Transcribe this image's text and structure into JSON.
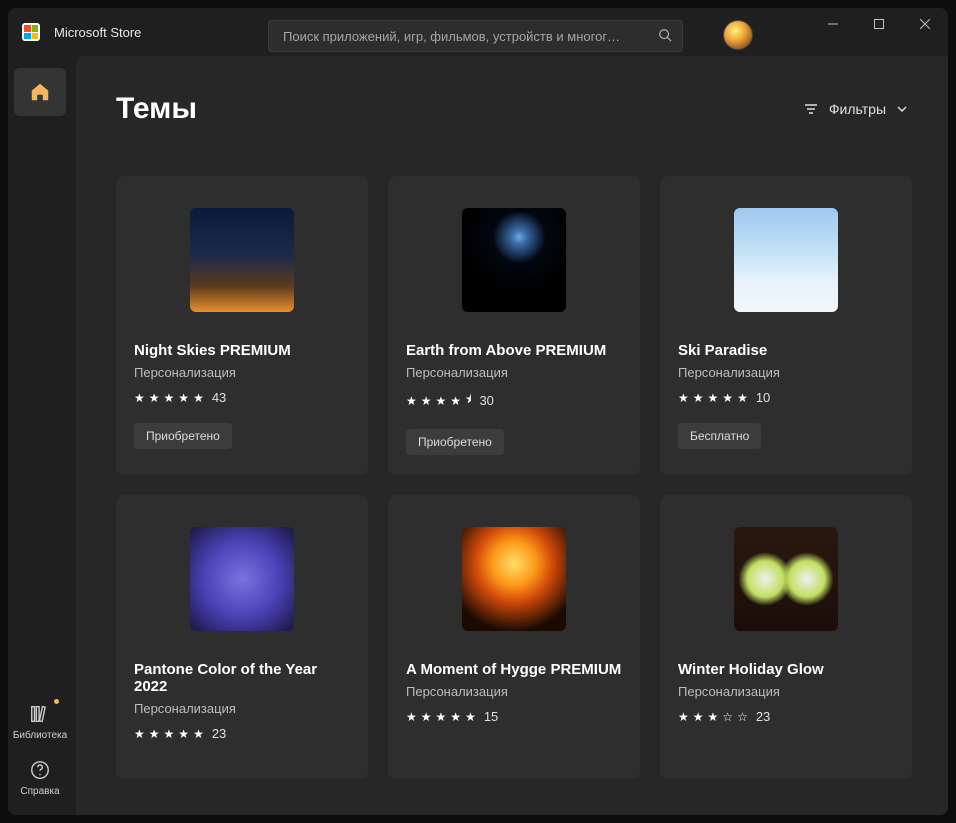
{
  "app": {
    "title": "Microsoft Store",
    "search_placeholder": "Поиск приложений, игр, фильмов, устройств и многог…"
  },
  "sidebar": {
    "library_label": "Библиотека",
    "help_label": "Справка"
  },
  "page": {
    "title": "Темы",
    "filters_label": "Фильтры"
  },
  "badges": {
    "purchased": "Приобретено",
    "free": "Бесплатно"
  },
  "themes": [
    {
      "title": "Night Skies PREMIUM",
      "category": "Персонализация",
      "rating": 5.0,
      "count": 43,
      "badge": "purchased",
      "thumb": "t0"
    },
    {
      "title": "Earth from Above PREMIUM",
      "category": "Персонализация",
      "rating": 4.5,
      "count": 30,
      "badge": "purchased",
      "thumb": "t1"
    },
    {
      "title": "Ski Paradise",
      "category": "Персонализация",
      "rating": 5.0,
      "count": 10,
      "badge": "free",
      "thumb": "t2"
    },
    {
      "title": "Pantone Color of the Year 2022",
      "category": "Персонализация",
      "rating": 5.0,
      "count": 23,
      "badge": null,
      "thumb": "t3"
    },
    {
      "title": "A Moment of Hygge PREMIUM",
      "category": "Персонализация",
      "rating": 5.0,
      "count": 15,
      "badge": null,
      "thumb": "t4"
    },
    {
      "title": "Winter Holiday Glow",
      "category": "Персонализация",
      "rating": 3.0,
      "count": 23,
      "badge": null,
      "thumb": "t5"
    }
  ]
}
